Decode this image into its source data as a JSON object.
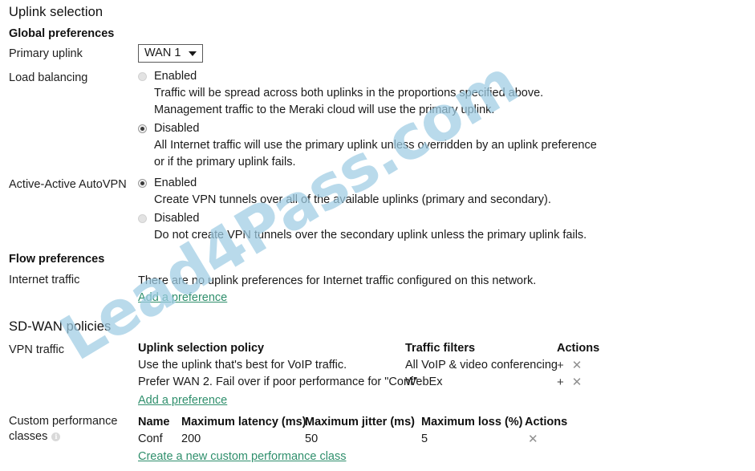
{
  "page": {
    "title": "Uplink selection"
  },
  "global_preferences": {
    "heading": "Global preferences",
    "primary_uplink": {
      "label": "Primary uplink",
      "value": "WAN 1",
      "caret_icon": "chevron-down-icon"
    },
    "load_balancing": {
      "label": "Load balancing",
      "selected": "Disabled",
      "options": [
        {
          "label": "Enabled",
          "checked": false,
          "desc_lines": [
            "Traffic will be spread across both uplinks in the proportions specified above.",
            "Management traffic to the Meraki cloud will use the primary uplink."
          ]
        },
        {
          "label": "Disabled",
          "checked": true,
          "desc_lines": [
            "All Internet traffic will use the primary uplink unless overridden by an uplink preference",
            "or if the  primary uplink fails."
          ]
        }
      ]
    },
    "active_active_autovpn": {
      "label": "Active-Active AutoVPN",
      "selected": "Enabled",
      "options": [
        {
          "label": "Enabled",
          "checked": true,
          "desc_lines": [
            "Create VPN tunnels over all of the available uplinks (primary and secondary)."
          ]
        },
        {
          "label": "Disabled",
          "checked": false,
          "desc_lines": [
            "Do not create VPN tunnels over the secondary uplink unless the primary uplink fails."
          ]
        }
      ]
    }
  },
  "flow_preferences": {
    "heading": "Flow preferences",
    "internet_traffic": {
      "label": "Internet traffic",
      "message": "There are no uplink preferences for Internet traffic configured on this network.",
      "add_link": "Add a preference"
    }
  },
  "sdwan_policies": {
    "heading": "SD-WAN policies",
    "vpn_traffic": {
      "label": "VPN traffic",
      "columns": {
        "policy": "Uplink selection policy",
        "filters": "Traffic filters",
        "actions": "Actions"
      },
      "rows": [
        {
          "policy": "Use the uplink that's best for VoIP traffic.",
          "filter": "All VoIP & video conferencing",
          "add_icon": "plus-icon",
          "delete_icon": "close-icon"
        },
        {
          "policy": "Prefer WAN 2. Fail over if poor performance for \"Conf\"",
          "filter": "WebEx",
          "add_icon": "plus-icon",
          "delete_icon": "close-icon"
        }
      ],
      "add_link": "Add a preference"
    },
    "custom_performance_classes": {
      "label_line1": "Custom performance",
      "label_line2": "classes",
      "info_icon": "info-icon",
      "columns": {
        "name": "Name",
        "max_latency": "Maximum latency (ms)",
        "max_jitter": "Maximum jitter (ms)",
        "max_loss": "Maximum loss (%)",
        "actions": "Actions"
      },
      "rows": [
        {
          "name": "Conf",
          "max_latency": "200",
          "max_jitter": "50",
          "max_loss": "5",
          "delete_icon": "close-icon"
        }
      ],
      "create_link": "Create a new custom performance class"
    }
  },
  "watermark": {
    "text": "Lead4Pass.com",
    "color": "#9fcde4"
  },
  "colors": {
    "link": "#2f8f6c",
    "text": "#1a1a1a",
    "radio_off": "#e3e3e3",
    "radio_on_dot": "#3a3a3a",
    "icon_x": "#8f8f8f"
  }
}
